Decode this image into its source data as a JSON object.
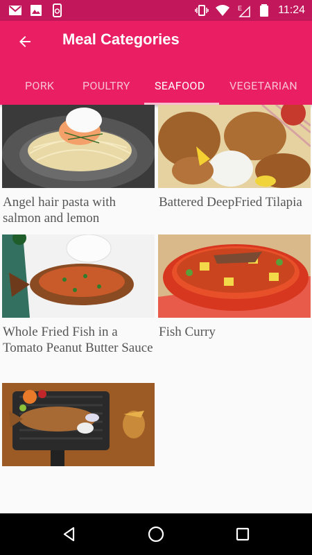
{
  "status_bar": {
    "time": "11:24",
    "left_icons": [
      "gmail-icon",
      "image-icon",
      "screenshot-icon"
    ],
    "right_icons": [
      "vibrate-icon",
      "wifi-icon",
      "signal-e-icon",
      "battery-icon"
    ]
  },
  "app_bar": {
    "title": "Meal Categories",
    "back_icon": "arrow-back-icon",
    "background": "#e91e63",
    "status_background": "#c2185b"
  },
  "tabs": [
    {
      "label": "PORK",
      "active": false
    },
    {
      "label": "POULTRY",
      "active": false
    },
    {
      "label": "SEAFOOD",
      "active": true
    },
    {
      "label": "VEGETARIAN",
      "active": false
    }
  ],
  "meals": [
    {
      "title": "Angel hair pasta with salmon and lemon"
    },
    {
      "title": "Battered DeepFried Tilapia"
    },
    {
      "title": "Whole Fried Fish in a Tomato Peanut Butter Sauce"
    },
    {
      "title": "Fish Curry"
    },
    {
      "title": ""
    }
  ],
  "nav_bar": {
    "icons": [
      "back-triangle-icon",
      "home-circle-icon",
      "recents-square-icon"
    ]
  }
}
